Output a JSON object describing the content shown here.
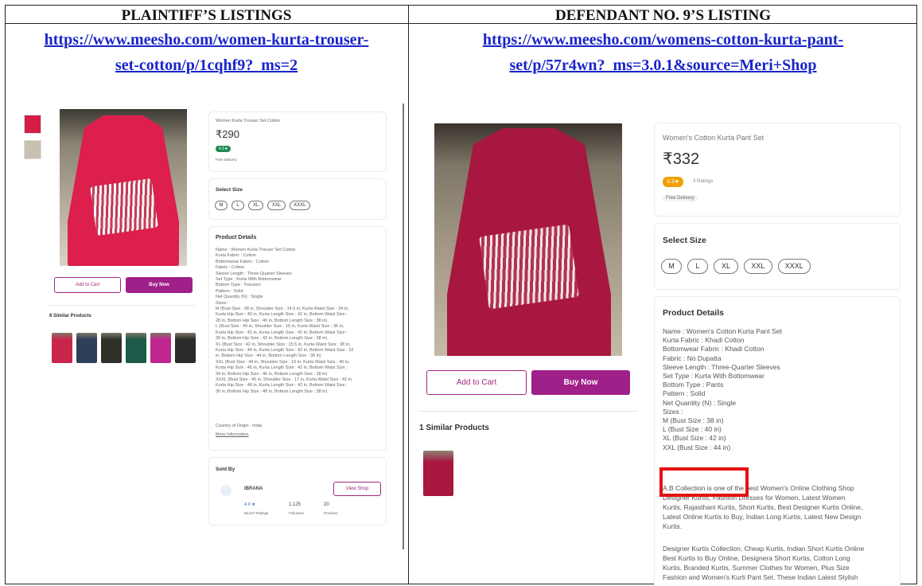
{
  "headers": {
    "left_title": "PLAINTIFF’S LISTINGS",
    "right_title": "DEFENDANT NO. 9’S LISTING",
    "left_url_line1": "https://www.meesho.com/women-kurta-trouser-",
    "left_url_line2": "set-cotton/p/1cqhf9?_ms=2",
    "right_url_line1": "https://www.meesho.com/womens-cotton-kurta-pant-",
    "right_url_line2": "set/p/57r4wn?_ms=3.0.1&source=Meri+Shop"
  },
  "plaintiff": {
    "product_title": "Women Kurta Trouser Set Cotton",
    "price": "₹290",
    "rating_badge": "4.1★",
    "delivery": "Free Delivery",
    "add_to_cart": "Add to Cart",
    "buy_now": "Buy Now",
    "select_size_label": "Select Size",
    "sizes": [
      "M",
      "L",
      "XL",
      "XXL",
      "XXXL"
    ],
    "product_details_label": "Product Details",
    "details": [
      "Name : Women Kurta Trouser Set Cotton",
      "Kurta Fabric : Cotton",
      "Bottomwear Fabric : Cotton",
      "Fabric : Cotton",
      "Sleeve Length : Three-Quarter Sleeves",
      "Set Type : Kurta With Bottomwear",
      "Bottom Type : Trousers",
      "Pattern : Solid",
      "Net Quantity (N) : Single",
      "Sizes :",
      "M (Bust Size : 38 in, Shoulder Size : 14.5 in, Kurta Waist Size : 34 in,",
      "Kurta Hip Size : 40 in, Kurta Length Size : 42 in, Bottom Waist Size :",
      "28 in, Bottom Hip Size : 40 in, Bottom Length Size : 38 in)",
      "L (Bust Size : 40 in, Shoulder Size : 15 in, Kurta Waist Size : 36 in,",
      "Kurta Hip Size : 42 in, Kurta Length Size : 42 in, Bottom Waist Size :",
      "30 in, Bottom Hip Size : 42 in, Bottom Length Size : 38 in)",
      "XL (Bust Size : 42 in, Shoulder Size : 15.5 in, Kurta Waist Size : 38 in,",
      "Kurta Hip Size : 44 in, Kurta Length Size : 42 in, Bottom Waist Size : 32",
      "in, Bottom Hip Size : 44 in, Bottom Length Size : 38 in)",
      "XXL (Bust Size : 44 in, Shoulder Size : 16 in, Kurta Waist Size : 40 in,",
      "Kurta Hip Size : 46 in, Kurta Length Size : 42 in, Bottom Waist Size :",
      "34 in, Bottom Hip Size : 46 in, Bottom Length Size : 38 in)",
      "XXXL (Bust Size : 46 in, Shoulder Size : 17 in, Kurta Waist Size : 42 in,",
      "Kurta Hip Size : 48 in, Kurta Length Size : 42 in, Bottom Waist Size :",
      "36 in, Bottom Hip Size : 48 in, Bottom Length Size : 38 in)"
    ],
    "country_line": "Country of Origin : India",
    "more_info": "More Information",
    "similar_label": "8 Similar Products",
    "similar_colors": [
      "#c8254a",
      "#2e3f58",
      "#30302b",
      "#1d5a4a",
      "#c0268f",
      "#2b2b2b"
    ],
    "sold_by_label": "Sold By",
    "seller_name": "IBRANA",
    "view_shop": "View Shop",
    "seller_rating": "4.0 ★",
    "seller_ratings_count": "56,817 Ratings",
    "followers_value": "1,125",
    "followers_label": "Followers",
    "products_value": "20",
    "products_label": "Products"
  },
  "defendant": {
    "product_title": "Women's Cotton Kurta Pant Set",
    "price": "₹332",
    "rating_badge": "3.3★",
    "ratings_count": "3 Ratings",
    "delivery": "Free Delivery",
    "add_to_cart": "Add to Cart",
    "buy_now": "Buy Now",
    "select_size_label": "Select Size",
    "sizes": [
      "M",
      "L",
      "XL",
      "XXL",
      "XXXL"
    ],
    "product_details_label": "Product Details",
    "details": [
      "Name : Women's Cotton Kurta Pant Set",
      "Kurta Fabric : Khadi Cotton",
      "Bottomwear Fabric : Khadi Cotton",
      "Fabric : No Dupatta",
      "Sleeve Length : Three-Quarter Sleeves",
      "Set Type : Kurta With Bottomwear",
      "Bottom Type : Pants",
      "Pattern : Solid",
      "Net Quantity (N) : Single",
      "Sizes :",
      "M (Bust Size : 38 in)",
      "L (Bust Size : 40 in)",
      "XL (Bust Size : 42 in)",
      "XXL (Bust Size : 44 in)"
    ],
    "description_p1": [
      "A.B Collection is one of the best Women's Online Clothing Shop",
      "Designer Kurtis, Fashion Dresses for Women, Latest Women",
      "Kurtis, Rajasthani Kurtis, Short Kurtis, Best Designer Kurtis Online,",
      "Latest Online Kurtis to Buy, Indian Long Kurtis, Latest New Design",
      "Kurtis."
    ],
    "description_p2": [
      "Designer Kurtis Collection, Cheap Kurtis, Indian Short Kurtis Online",
      "Best Kurtis to Buy Online, Designera Short Kurtis, Cotton Long",
      "Kurtis, Branded Kurtis, Summer Clothes for Women, Plus Size",
      "Fashion and Women's Kurti Pant Set. These Indian Latest Stylish"
    ],
    "similar_label": "1 Similar Products"
  },
  "colors": {
    "link": "#1a25c9",
    "meesho_purple": "#9f2089",
    "highlight_red": "#e3130f",
    "plaintiff_dress": "#dc1f4d",
    "defendant_dress": "#a8173f",
    "rating_green": "#1f8a52",
    "rating_amber": "#f0a000"
  }
}
